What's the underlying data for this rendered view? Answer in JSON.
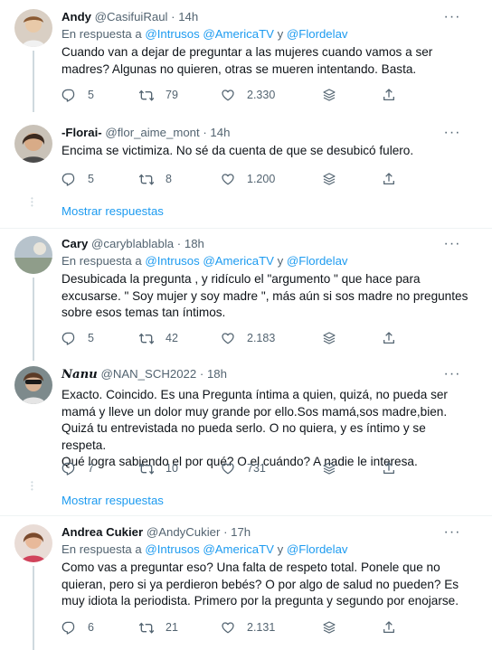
{
  "tweets": [
    {
      "name": "Andy",
      "handle": "@CasifuiRaul",
      "time": "14h",
      "reply_prefix": "En respuesta a ",
      "reply_mentions": "@Intrusos @AmericaTV",
      "reply_joiner": " y ",
      "reply_last": "@Flordelav",
      "text": "Cuando van a dejar de preguntar a las mujeres cuando vamos a ser\nmadres? Algunas no quieren, otras se mueren intentando. Basta.",
      "replies": "5",
      "retweets": "79",
      "likes": "2.330"
    },
    {
      "name": "-Florai-",
      "handle": "@flor_aime_mont",
      "time": "14h",
      "text": "Encima se victimiza. No sé da cuenta de que se desubicó fulero.",
      "replies": "5",
      "retweets": "8",
      "likes": "1.200"
    },
    {
      "name": "Cary",
      "handle": "@caryblablabla",
      "time": "18h",
      "reply_prefix": "En respuesta a ",
      "reply_mentions": "@Intrusos @AmericaTV",
      "reply_joiner": " y ",
      "reply_last": "@Flordelav",
      "text": "Desubicada la pregunta , y ridículo el \"argumento \" que hace para\nexcusarse. \" Soy mujer y soy madre \", más aún si sos madre no preguntes\nsobre esos temas tan íntimos.",
      "replies": "5",
      "retweets": "42",
      "likes": "2.183"
    },
    {
      "name": "𝑵𝒂𝒏𝒖",
      "handle": "@NAN_SCH2022",
      "time": "18h",
      "text": "Exacto. Coincido. Es una Pregunta íntima a quien, quizá, no pueda ser\nmamá y lleve un dolor muy grande por ello.Sos mamá,sos madre,bien.\nQuizá tu entrevistada no pueda serlo. O no quiera, y es íntimo y se respeta.\nQué logra sabiendo el por qué? O el cuándo? A nadie le interesa.",
      "replies": "7",
      "retweets": "10",
      "likes": "731"
    },
    {
      "name": "Andrea Cukier",
      "handle": "@AndyCukier",
      "time": "17h",
      "reply_prefix": "En respuesta a ",
      "reply_mentions": "@Intrusos @AmericaTV",
      "reply_joiner": " y ",
      "reply_last": "@Flordelav",
      "text": "Como vas a preguntar eso? Una falta de respeto total. Ponele que no\nquieran, pero si ya perdieron bebés? O por algo de salud no pueden? Es\nmuy idiota la periodista. Primero por la pregunta y segundo por enojarse.",
      "replies": "6",
      "retweets": "21",
      "likes": "2.131"
    }
  ],
  "show_replies_label": "Mostrar respuestas",
  "dot": "·",
  "more_glyph": "···",
  "icons": [
    "reply-icon",
    "retweet-icon",
    "like-icon",
    "share-icon",
    "activity-icon"
  ],
  "colors": {
    "accent": "#1d9bf0",
    "secondary_text": "#536471",
    "line": "#cfd9de"
  }
}
